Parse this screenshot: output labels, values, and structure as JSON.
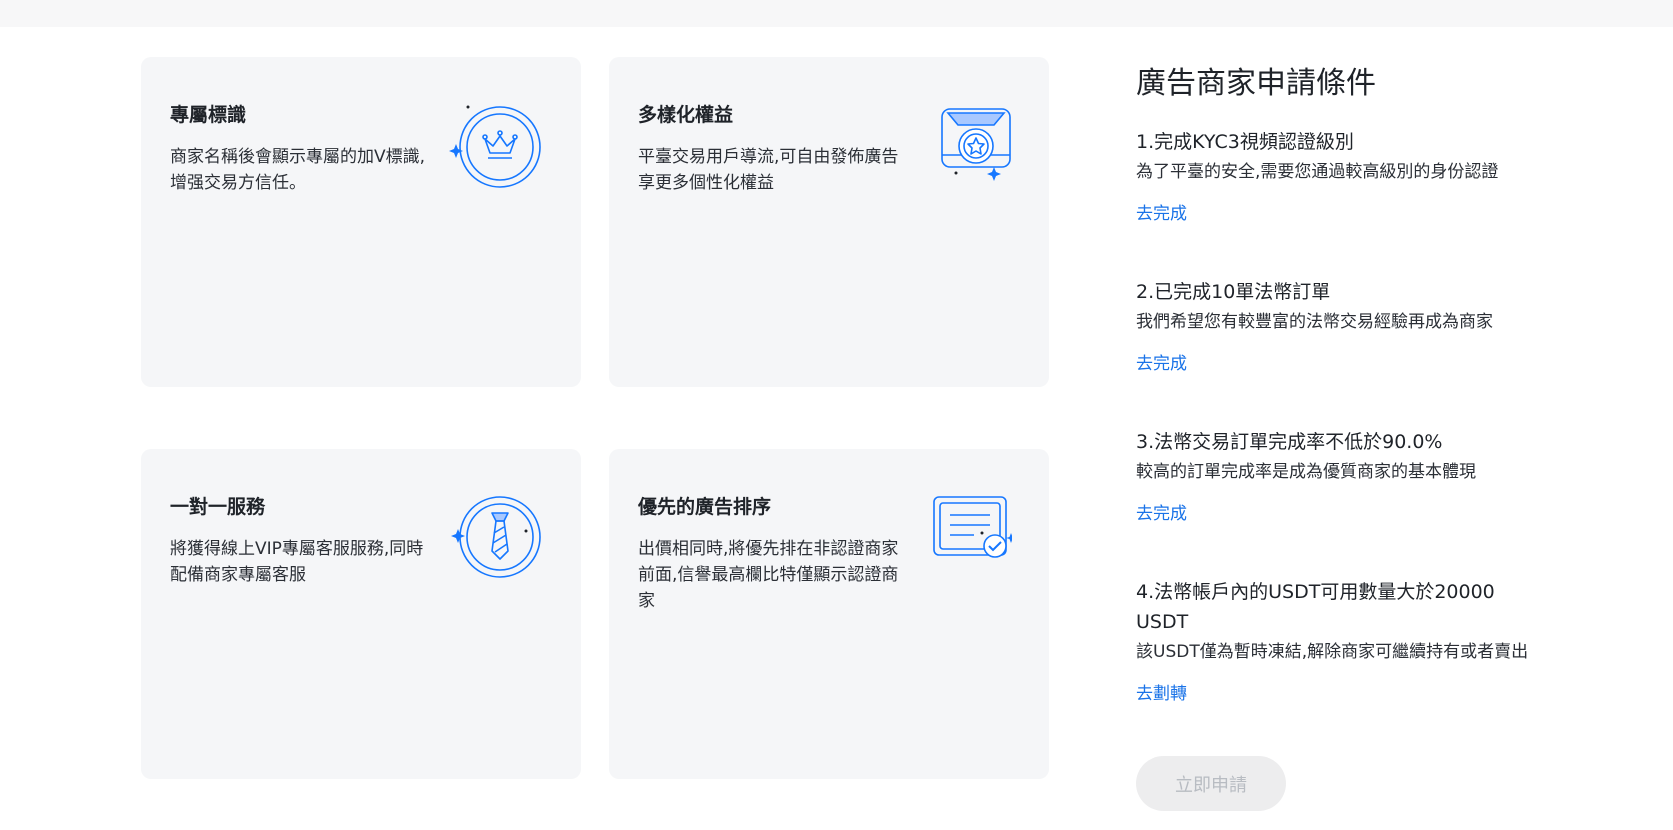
{
  "benefits": [
    {
      "title": "專屬標識",
      "desc": "商家名稱後會顯示專屬的加V標識,增强交易方信任。",
      "icon": "crown-badge-icon"
    },
    {
      "title": "多樣化權益",
      "desc": "平臺交易用戶導流,可自由發佈廣告享更多個性化權益",
      "icon": "medal-star-icon"
    },
    {
      "title": "一對一服務",
      "desc": "將獲得線上VIP專屬客服服務,同時配備商家專屬客服",
      "icon": "tie-badge-icon"
    },
    {
      "title": "優先的廣告排序",
      "desc": "出價相同時,將優先排在非認證商家前面,信譽最高欄比特僅顯示認證商家",
      "icon": "certificate-check-icon"
    }
  ],
  "conditions": {
    "title": "廣告商家申請條件",
    "items": [
      {
        "name": "1.完成KYC3視頻認證級別",
        "desc": "為了平臺的安全,需要您通過較高級別的身份認證",
        "link": "去完成"
      },
      {
        "name": "2.已完成10單法幣訂單",
        "desc": "我們希望您有較豐富的法幣交易經驗再成為商家",
        "link": "去完成"
      },
      {
        "name": "3.法幣交易訂單完成率不低於90.0%",
        "desc": "較高的訂單完成率是成為優質商家的基本體現",
        "link": "去完成"
      },
      {
        "name": "4.法幣帳戶內的USDT可用數量大於20000 USDT",
        "desc": "該USDT僅為暫時凍結,解除商家可繼續持有或者賣出",
        "link": "去劃轉"
      }
    ],
    "apply_label": "立即申請"
  },
  "colors": {
    "accent": "#1a73e8",
    "icon_blue": "#1677ff",
    "card_bg": "#f5f6f8"
  }
}
